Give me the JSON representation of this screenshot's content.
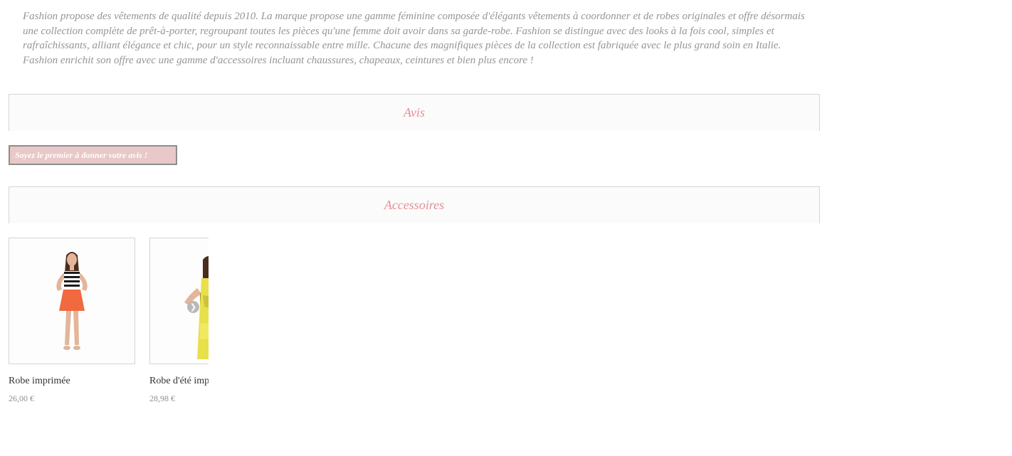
{
  "product_description": "Fashion propose des vêtements de qualité depuis 2010. La marque propose une gamme féminine composée d'élégants vêtements à coordonner et de robes originales et offre désormais une collection complète de prêt-à-porter, regroupant toutes les pièces qu'une femme doit avoir dans sa garde-robe. Fashion se distingue avec des looks à la fois cool, simples et rafraîchissants, alliant élégance et chic, pour un style reconnaissable entre mille. Chacune des magnifiques pièces de la collection est fabriquée avec le plus grand soin en Italie. Fashion enrichit son offre avec une gamme d'accessoires incluant chaussures, chapeaux, ceintures et bien plus encore !",
  "reviews": {
    "title": "Avis",
    "write_first_review_label": "Soyez le premier à donner votre avis !"
  },
  "accessories": {
    "title": "Accessoires",
    "next_icon": "chevron-right-icon",
    "products": [
      {
        "name": "Robe imprimée",
        "price": "26,00 €"
      },
      {
        "name": "Robe d'été imprimée",
        "price": "28,98 €"
      }
    ]
  },
  "colors": {
    "accent_title": "#e58e96",
    "description_text": "#959595",
    "button_bg": "#e8c8c8",
    "header_bg": "#fbfbfb"
  }
}
